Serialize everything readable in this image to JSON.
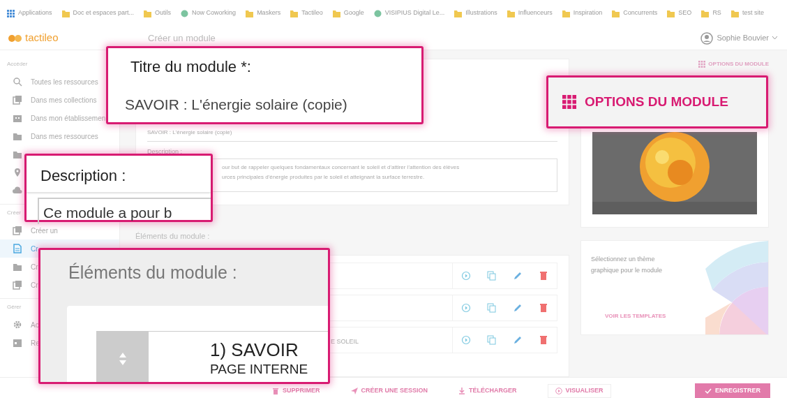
{
  "bookmarks": [
    {
      "label": "Applications",
      "kind": "apps"
    },
    {
      "label": "Doc et espaces part...",
      "kind": "folder"
    },
    {
      "label": "Outils",
      "kind": "folder"
    },
    {
      "label": "Now Coworking",
      "kind": "site"
    },
    {
      "label": "Maskers",
      "kind": "folder"
    },
    {
      "label": "Tactileo",
      "kind": "folder"
    },
    {
      "label": "Google",
      "kind": "folder"
    },
    {
      "label": "VISIPIUS Digital Le...",
      "kind": "site"
    },
    {
      "label": "Illustrations",
      "kind": "folder"
    },
    {
      "label": "Influenceurs",
      "kind": "folder"
    },
    {
      "label": "Inspiration",
      "kind": "folder"
    },
    {
      "label": "Concurrents",
      "kind": "folder"
    },
    {
      "label": "SEO",
      "kind": "folder"
    },
    {
      "label": "RS",
      "kind": "folder"
    },
    {
      "label": "test site",
      "kind": "folder"
    }
  ],
  "header": {
    "logo": "tactileo",
    "page_title": "Créer un module",
    "user": "Sophie Bouvier"
  },
  "sidebar": [
    {
      "title": "Accéder",
      "items": [
        {
          "label": "Toutes les ressources",
          "kind": "search",
          "selected": false
        },
        {
          "label": "Dans mes collections",
          "kind": "stack",
          "selected": false
        },
        {
          "label": "Dans mon établissemen",
          "kind": "building",
          "selected": false
        },
        {
          "label": "Dans mes ressources",
          "kind": "folder",
          "selected": false
        },
        {
          "kind": "folder",
          "selected": false
        },
        {
          "kind": "pin",
          "selected": false
        },
        {
          "kind": "cloud",
          "selected": false
        }
      ]
    },
    {
      "title": "Créer",
      "items": [
        {
          "label": "Créer un",
          "kind": "stack",
          "selected": false
        },
        {
          "label": "Cr",
          "kind": "document",
          "selected": true
        },
        {
          "label": "Cr",
          "kind": "folder",
          "selected": false
        },
        {
          "label": "Cr",
          "kind": "stack",
          "selected": false
        }
      ]
    },
    {
      "title": "Gérer",
      "items": [
        {
          "label": "Ac",
          "kind": "gear",
          "selected": false
        },
        {
          "label": "Re",
          "kind": "calendar",
          "selected": false
        }
      ]
    }
  ],
  "form": {
    "title_value": "SAVOIR : L'énergie solaire (copie)",
    "description_label": "Description :",
    "description_lines": [
      "our but de rappeler quelques fondamentaux concernant le soleil et d'attirer l'attention des élèves",
      "urces principales d'énergie produites par le soleil et atteignant la surface terrestre."
    ]
  },
  "elements": {
    "title": "Éléments du module :",
    "rows": [
      {
        "kind": "element"
      },
      {
        "kind": "element"
      },
      {
        "kind": "element",
        "title": "E SOLEIL"
      }
    ]
  },
  "options": {
    "label": "OPTIONS DU MODULE"
  },
  "theme_card": {
    "text": "Sélectionnez un thème graphique pour le module",
    "link": "VOIR LES TEMPLATES"
  },
  "bottom_bar": [
    {
      "label": "SUPPRIMER",
      "kind": "delete"
    },
    {
      "label": "CRÉER UNE SESSION",
      "kind": "send"
    },
    {
      "label": "TÉLÉCHARGER",
      "kind": "download"
    },
    {
      "label": "VISUALISER",
      "kind": "play"
    },
    {
      "label": "ENREGISTRER",
      "kind": "save"
    }
  ],
  "callouts": [
    {
      "kind": "title",
      "label": "Titre du module *:",
      "value": "SAVOIR : L'énergie solaire (copie)"
    },
    {
      "kind": "options",
      "label": "OPTIONS DU MODULE"
    },
    {
      "kind": "description",
      "label": "Description :",
      "value": "Ce module a pour b"
    },
    {
      "kind": "elements",
      "label": "Éléments du module :",
      "item_title": "1) SAVOIR",
      "item_type": "PAGE INTERNE"
    }
  ]
}
